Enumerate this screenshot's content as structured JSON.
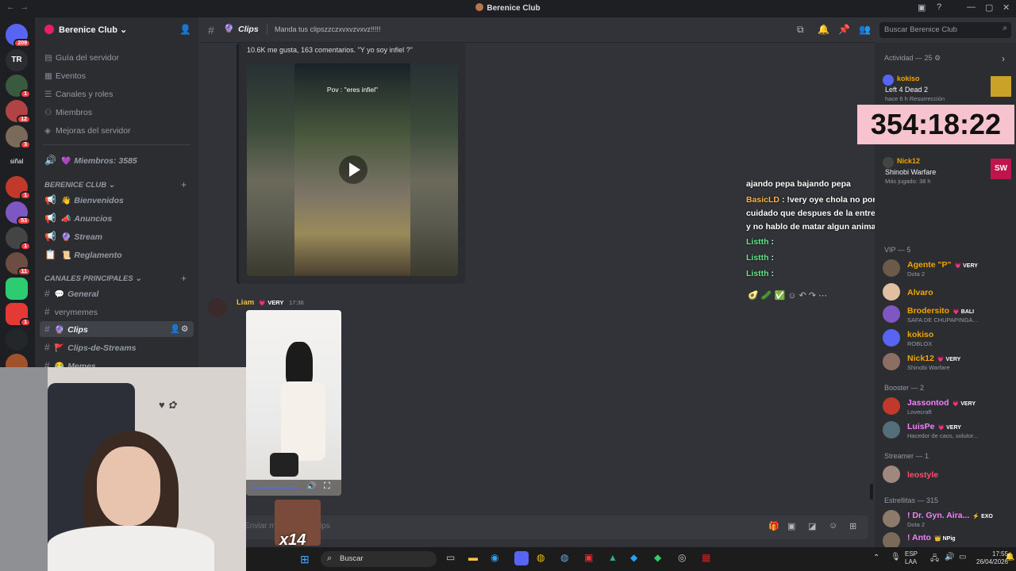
{
  "window": {
    "title": "Berenice Club"
  },
  "rail": {
    "badges": [
      "209",
      "1",
      "12",
      "3",
      "1",
      "1",
      "53",
      "1",
      "11",
      "1"
    ],
    "text_icon": "TR",
    "senal": "siñal"
  },
  "sidebar": {
    "server_name": "Berenice Club",
    "nav": [
      "Guía del servidor",
      "Eventos",
      "Canales y roles",
      "Miembros",
      "Mejoras del servidor"
    ],
    "members_channel": "Miembros: 3585",
    "cat1": "BERENICE CLUB",
    "cat1_channels": [
      "Bienvenidos",
      "Anuncios",
      "Stream",
      "Reglamento"
    ],
    "cat2": "CANALES PRINCIPALES",
    "cat2_channels": [
      "General",
      "verymemes",
      "Clips",
      "Clips-de-Streams",
      "Memes"
    ]
  },
  "topbar": {
    "channel": "Clips",
    "topic": "Manda tus clipszzczxvxvzvxvz!!!!!",
    "search_placeholder": "Buscar Berenice Club"
  },
  "chat": {
    "embed_caption": "10.6K me gusta, 163 comentarios. \"Y yo soy infiel ?\"",
    "video_overlay": "Pov : \"eres infiel\"",
    "message_author": "Liam",
    "author_tag": "VERY",
    "message_time": "17:36",
    "input_placeholder": "Enviar mensaje a #Clips",
    "input_channel": "Clips"
  },
  "overlay_chat": [
    {
      "user": "",
      "text": "ajando pepa  bajando pepa "
    },
    {
      "user": "BasicLD",
      "text": ": !very oye chola no pongas esa mrd en stream"
    },
    {
      "user": "",
      "text": "cuidado que despues de la entrevista sale un matadero completo lit"
    },
    {
      "user": "",
      "text": "y no hablo de matar algun animal o cosa"
    },
    {
      "user": "Listth",
      "text": ":"
    },
    {
      "user": "Listth",
      "text": ":"
    },
    {
      "user": "Listth",
      "text": ":"
    }
  ],
  "timer": "354:18:22",
  "activity": {
    "header": "Actividad — 25",
    "items": [
      {
        "name": "kokiso",
        "game": "Left 4 Dead 2",
        "meta": "hace 6 h  Resurrección"
      },
      {
        "name": "Nick12",
        "game": "Shinobi Warfare",
        "meta": "Más jugado: 38 h"
      }
    ]
  },
  "members": {
    "vip_header": "VIP — 5",
    "vip": [
      {
        "name": "Agente \"P\"",
        "tag": "VERY",
        "status": "Dota 2",
        "color": "#f0a500"
      },
      {
        "name": "Alvaro",
        "tag": "",
        "status": "",
        "color": "#f0a500"
      },
      {
        "name": "Brodersito",
        "tag": "BALI",
        "status": "SAFA DE CHUPAPINGA...",
        "color": "#f0a500"
      },
      {
        "name": "kokiso",
        "tag": "",
        "status": "ROBLOX",
        "color": "#f0a500"
      },
      {
        "name": "Nick12",
        "tag": "VERY",
        "status": "Shinobi Warfare",
        "color": "#f0a500"
      }
    ],
    "booster_header": "Booster — 2",
    "boosters": [
      {
        "name": "Jassontod",
        "tag": "VERY",
        "status": "Lovecraft",
        "color": "#f47fff"
      },
      {
        "name": "LuisPe",
        "tag": "VERY",
        "status": "Hacedor de caos, solutor...",
        "color": "#f47fff"
      }
    ],
    "streamer_header": "Streamer — 1",
    "streamers": [
      {
        "name": "leostyle",
        "tag": "",
        "status": "",
        "color": "#ff4d6d"
      }
    ],
    "estrellitas_header": "Estrellitas — 315",
    "estrellitas": [
      {
        "name": "! Dr. Gyn. Aira...",
        "tag": "EXO",
        "status": "Dota 2",
        "color": "#f47fff"
      },
      {
        "name": "! Anto",
        "tag": "NPig",
        "status": "",
        "color": "#f47fff"
      }
    ]
  },
  "taskbar": {
    "search": "Buscar",
    "lang": "ESP",
    "lang2": "LAA",
    "time": "17:55",
    "date": "26/04/2026"
  },
  "sticker": {
    "label": "x14"
  }
}
